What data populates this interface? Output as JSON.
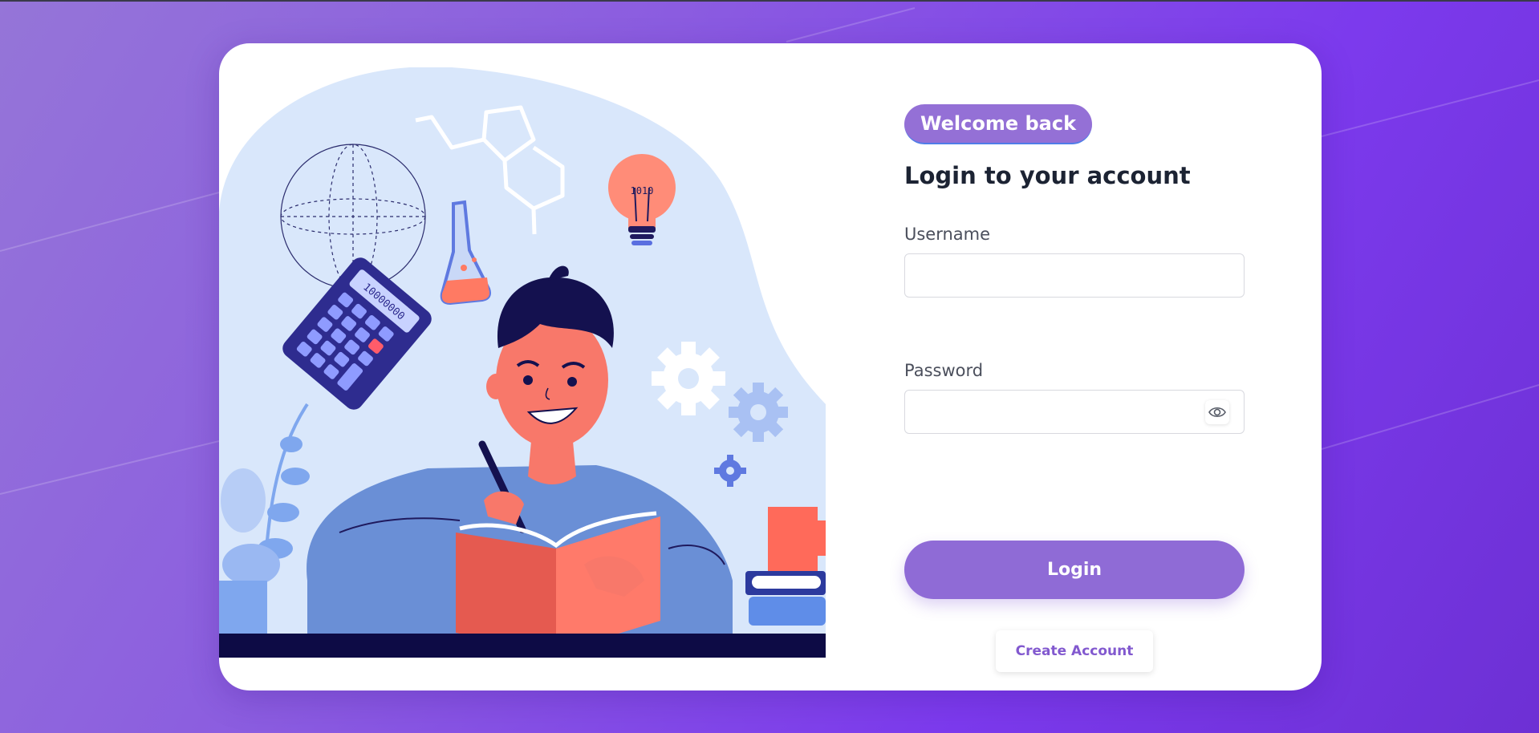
{
  "form": {
    "badge": "Welcome back",
    "title": "Login to your account",
    "username_label": "Username",
    "username_value": "",
    "password_label": "Password",
    "password_value": "",
    "login_label": "Login",
    "create_account_label": "Create Account"
  },
  "illustration": {
    "calculator_display": "10000000",
    "bulb_text": "1010"
  },
  "colors": {
    "background": "#7c3aed",
    "accent": "#8f6bd6",
    "heading": "#1c2333",
    "link": "#8259cf"
  },
  "icons": [
    "eye-icon",
    "gear-icon",
    "lightbulb-icon",
    "calculator-icon",
    "flask-icon",
    "globe-icon",
    "book-icon"
  ]
}
